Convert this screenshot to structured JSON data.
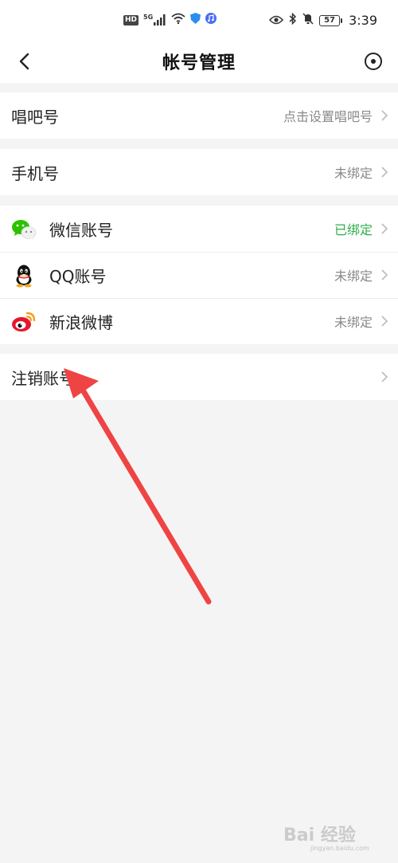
{
  "status_bar": {
    "left_badge": "HD",
    "network": "5G",
    "battery": "57",
    "time": "3:39",
    "icons": [
      "hd-icon",
      "signal-icon",
      "wifi-icon",
      "shield-icon",
      "music-app-icon",
      "eye-icon",
      "bluetooth-icon",
      "mute-icon",
      "battery-icon"
    ]
  },
  "header": {
    "title": "帐号管理",
    "back_icon": "back-arrow-icon",
    "more_icon": "more-circle-icon"
  },
  "groups": {
    "changba_id": {
      "label": "唱吧号",
      "value": "点击设置唱吧号"
    },
    "phone": {
      "label": "手机号",
      "value": "未绑定"
    },
    "social": [
      {
        "label": "微信账号",
        "value": "已绑定",
        "icon": "wechat-icon"
      },
      {
        "label": "QQ账号",
        "value": "未绑定",
        "icon": "qq-icon"
      },
      {
        "label": "新浪微博",
        "value": "未绑定",
        "icon": "weibo-icon"
      }
    ],
    "cancel_account": {
      "label": "注销账号"
    }
  },
  "colors": {
    "background": "#f4f4f4",
    "bound_text": "#2fae4a",
    "muted_text": "#888888",
    "annotation_arrow": "#ef4444"
  },
  "watermark": {
    "text": "Bai 经验",
    "sub": "jingyan.baidu.com"
  }
}
